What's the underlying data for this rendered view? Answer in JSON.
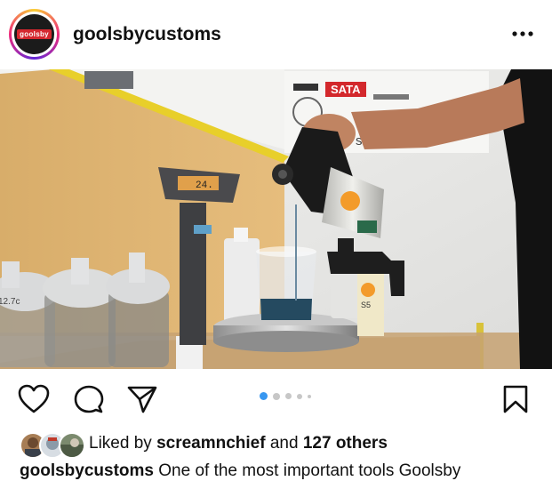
{
  "post": {
    "username": "goolsbycustoms",
    "avatar_logo_text": "goolsby",
    "photo_labels": {
      "brand_sign": "SATA",
      "sign_text": "sion Hu",
      "scale_display": "24.",
      "cup_label": "S5"
    },
    "carousel": {
      "count": 5,
      "active_index": 0
    }
  },
  "likes": {
    "prefix": "Liked by",
    "user": "screamnchief",
    "joiner": "and",
    "count_text": "127 others"
  },
  "caption": {
    "username": "goolsbycustoms",
    "text": "One of the most important tools Goolsby"
  },
  "icons": {
    "more": "more-horizontal-icon",
    "like": "heart-icon",
    "comment": "comment-bubble-icon",
    "share": "paper-plane-icon",
    "save": "bookmark-icon"
  },
  "colors": {
    "active_dot": "#3897f0",
    "inactive_dot": "#c7c7c7",
    "text": "#111111"
  }
}
